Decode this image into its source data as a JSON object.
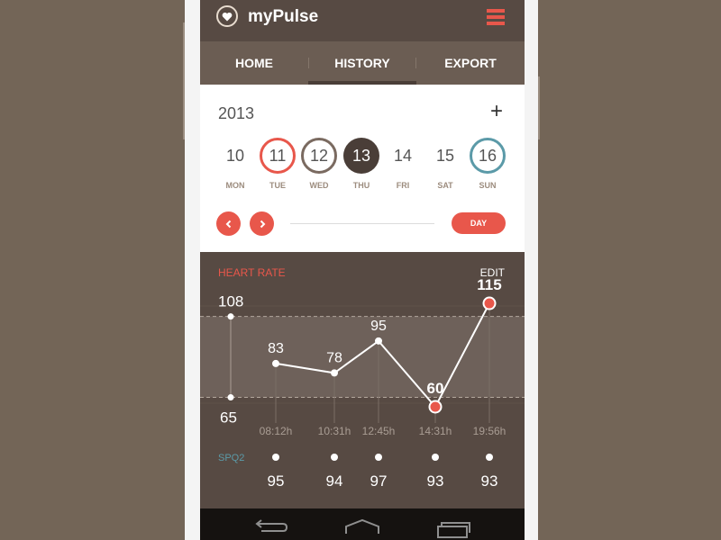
{
  "app": {
    "title": "myPulse"
  },
  "tabs": [
    {
      "label": "HOME",
      "active": false
    },
    {
      "label": "HISTORY",
      "active": true
    },
    {
      "label": "EXPORT",
      "active": false
    }
  ],
  "calendar": {
    "year": "2013",
    "add_label": "+",
    "days": [
      {
        "num": "10",
        "weekday": "MON",
        "ring": ""
      },
      {
        "num": "11",
        "weekday": "TUE",
        "ring": "#e8574b"
      },
      {
        "num": "12",
        "weekday": "WED",
        "ring": "#7a6a60"
      },
      {
        "num": "13",
        "weekday": "THU",
        "ring": "selected"
      },
      {
        "num": "14",
        "weekday": "FRI",
        "ring": ""
      },
      {
        "num": "15",
        "weekday": "SAT",
        "ring": ""
      },
      {
        "num": "16",
        "weekday": "SUN",
        "ring": "#5b9aa8"
      }
    ],
    "range_label": "DAY"
  },
  "heart_rate": {
    "title": "HEART RATE",
    "edit_label": "EDIT",
    "range_high": "108",
    "range_low": "65",
    "points": [
      {
        "time": "08:12h",
        "value": 83,
        "label": "83",
        "highlight": false
      },
      {
        "time": "10:31h",
        "value": 78,
        "label": "78",
        "highlight": false
      },
      {
        "time": "12:45h",
        "value": 95,
        "label": "95",
        "highlight": false
      },
      {
        "time": "14:31h",
        "value": 60,
        "label": "60",
        "highlight": true
      },
      {
        "time": "19:56h",
        "value": 115,
        "label": "115",
        "highlight": true
      }
    ]
  },
  "spo2": {
    "label": "SPQ2",
    "values": [
      "95",
      "94",
      "97",
      "93",
      "93"
    ]
  },
  "colors": {
    "accent": "#e8574b",
    "dark": "#574a43",
    "teal": "#5b9aa8"
  },
  "chart_data": {
    "type": "line",
    "title": "HEART RATE",
    "categories": [
      "08:12h",
      "10:31h",
      "12:45h",
      "14:31h",
      "19:56h"
    ],
    "series": [
      {
        "values": [
          83,
          78,
          95,
          60,
          115
        ]
      }
    ],
    "reference_band": [
      65,
      108
    ],
    "grid": false
  }
}
